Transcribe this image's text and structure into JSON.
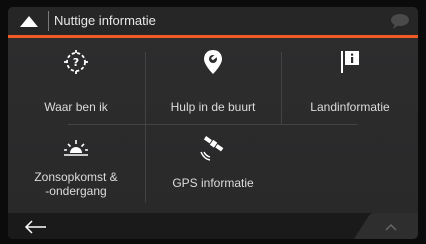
{
  "header": {
    "title": "Nuttige informatie"
  },
  "menu": {
    "items": [
      {
        "label": "Waar ben ik",
        "icon": "question-location-icon"
      },
      {
        "label": "Hulp in de buurt",
        "icon": "location-wrench-icon"
      },
      {
        "label": "Landinformatie",
        "icon": "info-flag-icon"
      },
      {
        "label": "Zonsopkomst &\n-ondergang",
        "icon": "sunrise-icon"
      },
      {
        "label": "GPS informatie",
        "icon": "satellite-icon"
      }
    ]
  },
  "colors": {
    "accent": "#f05a24",
    "background": "#2a2a2b",
    "text": "#dcdcdc"
  }
}
